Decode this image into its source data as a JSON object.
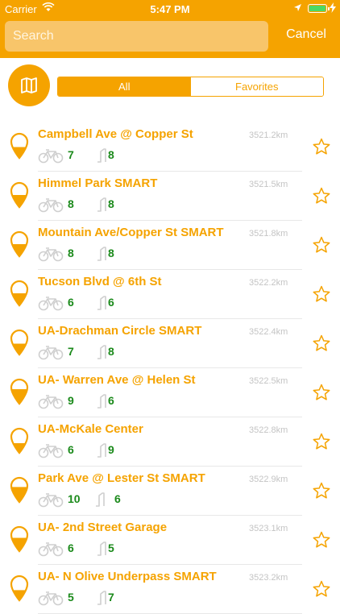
{
  "status_bar": {
    "carrier": "Carrier",
    "time": "5:47 PM"
  },
  "search": {
    "placeholder": "Search",
    "value": ""
  },
  "cancel_label": "Cancel",
  "segments": {
    "all": "All",
    "favorites": "Favorites"
  },
  "accent_color": "#f5a300",
  "available_color": "#1b8a1b",
  "stations": [
    {
      "name": "Campbell Ave @ Copper St",
      "distance": "3521.2km",
      "bikes": "7",
      "docks": "8",
      "fill": 0.45
    },
    {
      "name": "Himmel Park SMART",
      "distance": "3521.5km",
      "bikes": "8",
      "docks": "8",
      "fill": 0.5
    },
    {
      "name": "Mountain Ave/Copper St SMART",
      "distance": "3521.8km",
      "bikes": "8",
      "docks": "8",
      "fill": 0.5
    },
    {
      "name": "Tucson Blvd @ 6th St",
      "distance": "3522.2km",
      "bikes": "6",
      "docks": "6",
      "fill": 0.5
    },
    {
      "name": "UA-Drachman Circle SMART",
      "distance": "3522.4km",
      "bikes": "7",
      "docks": "8",
      "fill": 0.45
    },
    {
      "name": "UA- Warren Ave @ Helen St",
      "distance": "3522.5km",
      "bikes": "9",
      "docks": "6",
      "fill": 0.6
    },
    {
      "name": "UA-McKale Center",
      "distance": "3522.8km",
      "bikes": "6",
      "docks": "9",
      "fill": 0.4
    },
    {
      "name": "Park Ave @ Lester St SMART",
      "distance": "3522.9km",
      "bikes": "10",
      "docks": "6",
      "fill": 0.62
    },
    {
      "name": "UA- 2nd Street Garage",
      "distance": "3523.1km",
      "bikes": "6",
      "docks": "5",
      "fill": 0.55
    },
    {
      "name": "UA- N Olive Underpass SMART",
      "distance": "3523.2km",
      "bikes": "5",
      "docks": "7",
      "fill": 0.42
    }
  ]
}
